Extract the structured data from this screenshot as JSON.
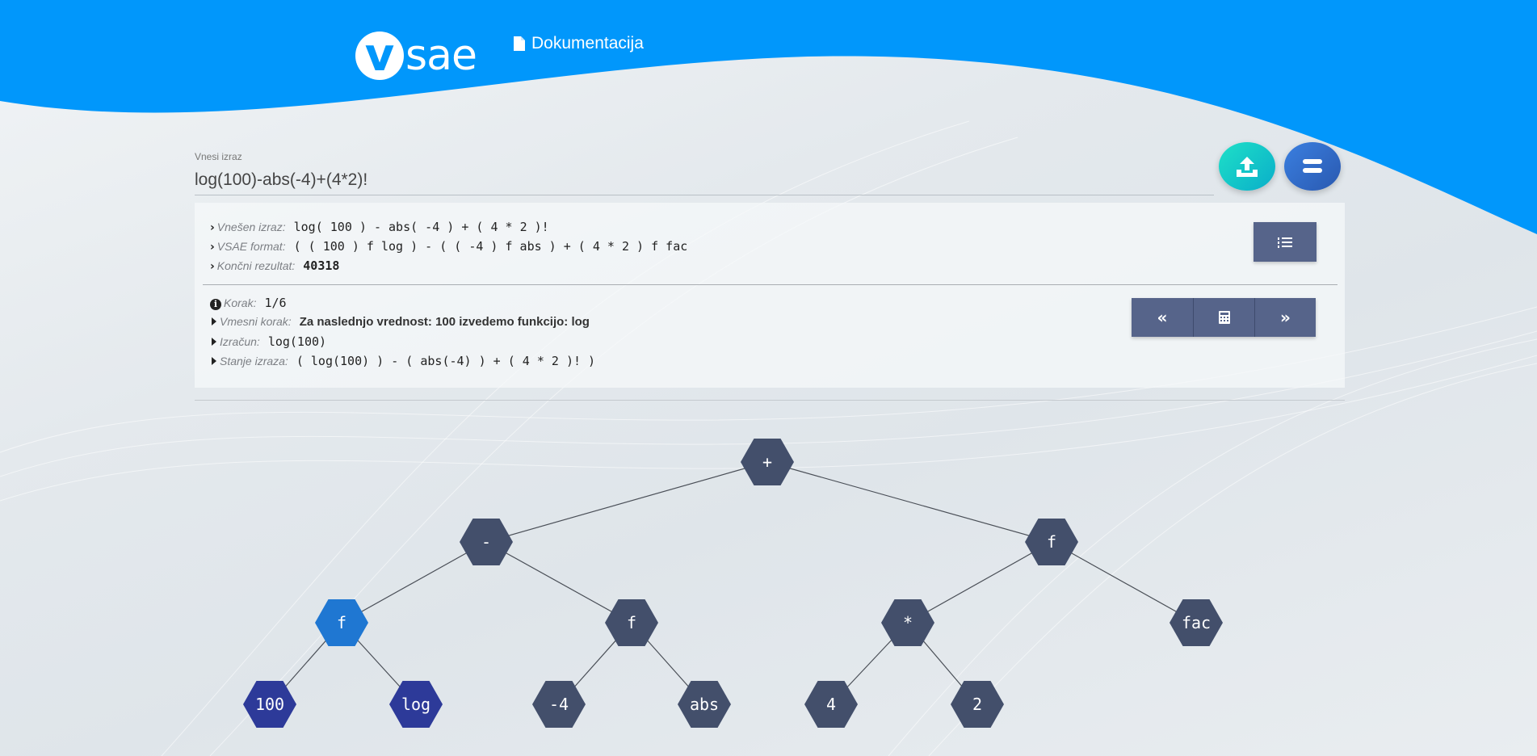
{
  "header": {
    "logo_v": "v",
    "logo_text": "sae",
    "doc_link_label": "Dokumentacija",
    "doc_icon": "file-icon"
  },
  "input": {
    "label": "Vnesi izraz",
    "value": "log(100)-abs(-4)+(4*2)!"
  },
  "actions": {
    "upload_icon": "upload-icon",
    "equals_icon": "equals-icon"
  },
  "summary": {
    "entered_label": "Vnešen izraz:",
    "entered_value": "log( 100 ) - abs( -4 ) + ( 4 * 2 )!",
    "format_label": "VSAE format:",
    "format_value": "( ( 100 ) f log ) - ( ( -4 ) f abs ) + ( 4 * 2 ) f fac",
    "result_label": "Končni rezultat:",
    "result_value": "40318",
    "list_icon": "ordered-list-icon"
  },
  "step": {
    "step_label": "Korak:",
    "step_value": "1/6",
    "intermediate_label": "Vmesni korak:",
    "intermediate_value": "Za naslednjo vrednost: 100 izvedemo funkcijo: log",
    "calc_label": "Izračun:",
    "calc_value": "log(100)",
    "state_label": "Stanje izraza:",
    "state_value": "( log(100) ) - ( abs(-4) ) + ( 4 * 2 )! )",
    "prev_symbol": "«",
    "next_symbol": "»",
    "calculator_icon": "calculator-icon"
  },
  "tree": {
    "colors": {
      "default": "#434f6b",
      "active": "#1f77d2",
      "operand": "#2d3a99"
    },
    "nodes": [
      {
        "id": "n-plus",
        "label": "+",
        "state": "default"
      },
      {
        "id": "n-minus",
        "label": "-",
        "state": "default"
      },
      {
        "id": "n-f-right",
        "label": "f",
        "state": "default"
      },
      {
        "id": "n-f-log",
        "label": "f",
        "state": "active"
      },
      {
        "id": "n-f-abs",
        "label": "f",
        "state": "default"
      },
      {
        "id": "n-mul",
        "label": "*",
        "state": "default"
      },
      {
        "id": "n-fac",
        "label": "fac",
        "state": "default"
      },
      {
        "id": "n-100",
        "label": "100",
        "state": "operand"
      },
      {
        "id": "n-log",
        "label": "log",
        "state": "operand"
      },
      {
        "id": "n-neg4",
        "label": "-4",
        "state": "default"
      },
      {
        "id": "n-abs",
        "label": "abs",
        "state": "default"
      },
      {
        "id": "n-4",
        "label": "4",
        "state": "default"
      },
      {
        "id": "n-2",
        "label": "2",
        "state": "default"
      }
    ],
    "edges": [
      [
        "n-plus",
        "n-minus"
      ],
      [
        "n-plus",
        "n-f-right"
      ],
      [
        "n-minus",
        "n-f-log"
      ],
      [
        "n-minus",
        "n-f-abs"
      ],
      [
        "n-f-right",
        "n-mul"
      ],
      [
        "n-f-right",
        "n-fac"
      ],
      [
        "n-f-log",
        "n-100"
      ],
      [
        "n-f-log",
        "n-log"
      ],
      [
        "n-f-abs",
        "n-neg4"
      ],
      [
        "n-f-abs",
        "n-abs"
      ],
      [
        "n-mul",
        "n-4"
      ],
      [
        "n-mul",
        "n-2"
      ]
    ]
  }
}
